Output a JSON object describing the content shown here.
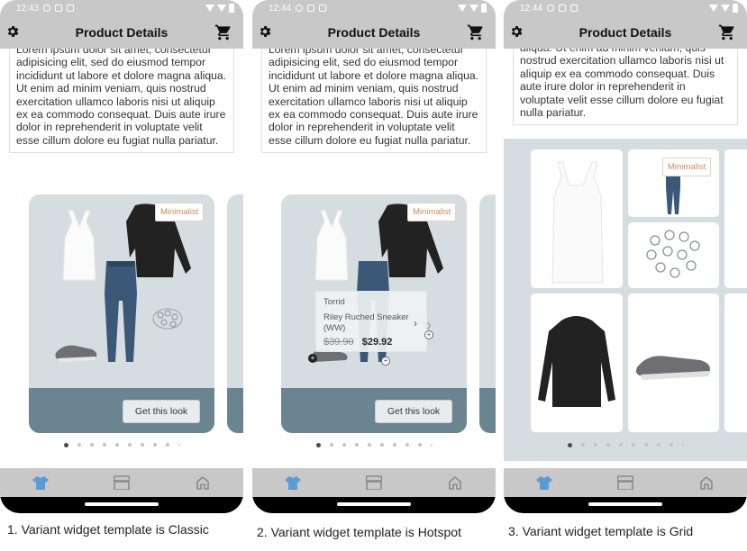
{
  "phones": [
    {
      "status_time": "12:43",
      "title": "Product Details",
      "description": "Lorem ipsum dolor sit amet, consectetur adipisicing elit, sed do eiusmod tempor incididunt ut labore et dolore magna aliqua. Ut enim ad minim veniam, quis nostrud exercitation ullamco laboris nisi ut aliquip ex ea commodo consequat. Duis aute irure dolor in reprehenderit in voluptate velit esse cillum dolore eu fugiat nulla pariatur.",
      "tag": "Minimalist",
      "button": "Get this look",
      "caption": "1. Variant widget template is Classic"
    },
    {
      "status_time": "12:44",
      "title": "Product Details",
      "description": "Lorem ipsum dolor sit amet, consectetur adipisicing elit, sed do eiusmod tempor incididunt ut labore et dolore magna aliqua. Ut enim ad minim veniam, quis nostrud exercitation ullamco laboris nisi ut aliquip ex ea commodo consequat. Duis aute irure dolor in reprehenderit in voluptate velit esse cillum dolore eu fugiat nulla pariatur.",
      "tag": "Minimalist",
      "button": "Get this look",
      "popup": {
        "brand": "Torrid",
        "name": "Riley Ruched Sneaker (WW)",
        "old_price": "$39.90",
        "new_price": "$29.92"
      },
      "caption": "2. Variant widget template is Hotspot"
    },
    {
      "status_time": "12:44",
      "title": "Product Details",
      "description": "aliqua. Ut enim ad minim veniam, quis nostrud exercitation ullamco laboris nisi ut aliquip ex ea commodo consequat. Duis aute irure dolor in reprehenderit in voluptate velit esse cillum dolore eu fugiat nulla pariatur.",
      "tag": "Minimalist",
      "caption": "3. Variant widget template is Grid"
    }
  ],
  "tabs": [
    "shirt-icon",
    "store-icon",
    "home-icon"
  ],
  "colors": {
    "bar_gray": "#c8c8c8",
    "card_bg": "#d6dde0",
    "card_footer": "#6b8590",
    "tag_text": "#d08a5c",
    "active_tab": "#5b9bd5"
  }
}
